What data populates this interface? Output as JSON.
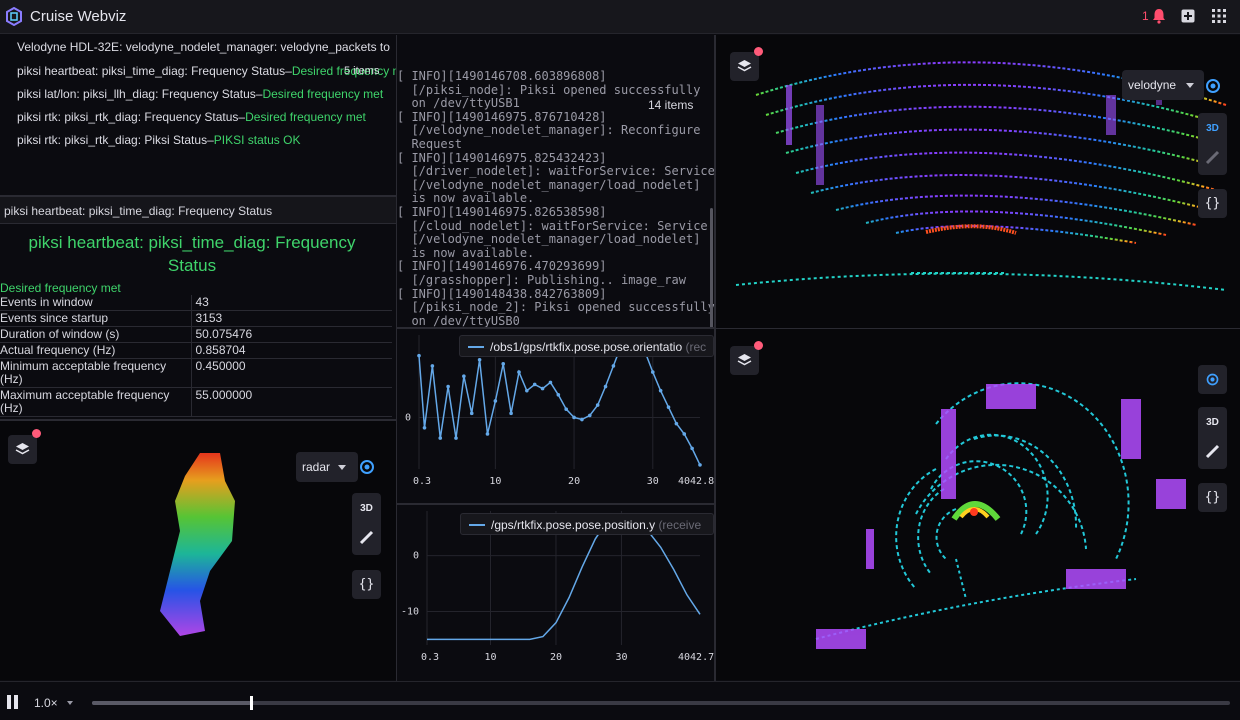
{
  "app": {
    "title": "Cruise Webviz",
    "notification_count": "1"
  },
  "diagnostics": {
    "item_count": "5 items",
    "items": [
      {
        "label": "Velodyne HDL-32E: velodyne_nodelet_manager: velodyne_packets to",
        "status": ""
      },
      {
        "label": "piksi heartbeat: piksi_time_diag: Frequency Status–",
        "status": "Desired frequency met"
      },
      {
        "label": "piksi lat/lon: piksi_llh_diag: Frequency Status–",
        "status": "Desired frequency met"
      },
      {
        "label": "piksi rtk: piksi_rtk_diag: Frequency Status–",
        "status": "Desired frequency met"
      },
      {
        "label": "piksi rtk: piksi_rtk_diag: Piksi Status–",
        "status": "PIKSI status OK"
      }
    ]
  },
  "detail": {
    "header": "piksi heartbeat: piksi_time_diag: Frequency Status",
    "title_line1": "piksi heartbeat: piksi_time_diag: Frequency",
    "title_line2": "Status",
    "status": "Desired frequency met",
    "rows": [
      {
        "key": "Events in window",
        "value": "43"
      },
      {
        "key": "Events since startup",
        "value": "3153"
      },
      {
        "key": "Duration of window (s)",
        "value": "50.075476"
      },
      {
        "key": "Actual frequency (Hz)",
        "value": "0.858704"
      },
      {
        "key": "Minimum acceptable frequency (Hz)",
        "value": "0.450000"
      },
      {
        "key": "Maximum acceptable frequency (Hz)",
        "value": "55.000000"
      }
    ]
  },
  "log": {
    "item_count": "14 items",
    "lines": [
      "[ INFO][1490146708.603896808]",
      "  [/piksi_node]: Piksi opened successfully",
      "  on /dev/ttyUSB1",
      "[ INFO][1490146975.876710428]",
      "  [/velodyne_nodelet_manager]: Reconfigure",
      "  Request",
      "[ INFO][1490146975.825432423]",
      "  [/driver_nodelet]: waitForService: Service",
      "  [/velodyne_nodelet_manager/load_nodelet]",
      "  is now available.",
      "[ INFO][1490146975.826538598]",
      "  [/cloud_nodelet]: waitForService: Service",
      "  [/velodyne_nodelet_manager/load_nodelet]",
      "  is now available.",
      "[ INFO][1490146976.470293699]",
      "  [/grasshopper]: Publishing.. image_raw",
      "[ INFO][1490148438.842763809]",
      "  [/piksi_node_2]: Piksi opened successfully",
      "  on /dev/ttyUSB0"
    ]
  },
  "plot_orientation": {
    "legend": "/obs1/gps/rtkfix.pose.pose.orientatio",
    "legend_suffix": "(rec",
    "x_ticks": [
      "0.3",
      "10",
      "20",
      "30",
      "4042.8"
    ],
    "y_ticks": [
      "0"
    ],
    "chart_data": {
      "type": "line",
      "series": [
        {
          "name": "/obs1/gps/rtkfix.pose.pose.orientatio",
          "points": [
            [
              0.3,
              3
            ],
            [
              1,
              -0.5
            ],
            [
              2,
              2.5
            ],
            [
              3,
              -1
            ],
            [
              4,
              1.5
            ],
            [
              5,
              -1
            ],
            [
              6,
              2
            ],
            [
              7,
              0.2
            ],
            [
              8,
              2.8
            ],
            [
              9,
              -0.8
            ],
            [
              10,
              0.8
            ],
            [
              11,
              2.6
            ],
            [
              12,
              0.2
            ],
            [
              13,
              2.2
            ],
            [
              14,
              1.3
            ],
            [
              15,
              1.6
            ],
            [
              16,
              1.4
            ],
            [
              17,
              1.7
            ],
            [
              18,
              1.1
            ],
            [
              19,
              0.4
            ],
            [
              20,
              0
            ],
            [
              21,
              -0.1
            ],
            [
              22,
              0.1
            ],
            [
              23,
              0.6
            ],
            [
              24,
              1.5
            ],
            [
              25,
              2.5
            ],
            [
              26,
              3.5
            ],
            [
              27,
              3.9
            ],
            [
              28,
              3.7
            ],
            [
              29,
              3.2
            ],
            [
              30,
              2.2
            ],
            [
              31,
              1.3
            ],
            [
              32,
              0.5
            ],
            [
              33,
              -0.3
            ],
            [
              34,
              -0.8
            ],
            [
              35,
              -1.5
            ],
            [
              36,
              -2.3
            ]
          ]
        }
      ]
    }
  },
  "plot_position": {
    "legend": "/gps/rtkfix.pose.pose.position.y",
    "legend_suffix": "(receive",
    "x_ticks": [
      "0.3",
      "10",
      "20",
      "30",
      "4042.7"
    ],
    "y_ticks": [
      "0",
      "-10"
    ],
    "chart_data": {
      "type": "line",
      "series": [
        {
          "name": "/gps/rtkfix.pose.pose.position.y",
          "points": [
            [
              0.3,
              -15
            ],
            [
              10,
              -15
            ],
            [
              16,
              -15
            ],
            [
              18,
              -14.5
            ],
            [
              20,
              -12
            ],
            [
              22,
              -7.5
            ],
            [
              24,
              -2
            ],
            [
              26,
              3
            ],
            [
              28,
              6.5
            ],
            [
              30,
              7.5
            ],
            [
              32,
              6.5
            ],
            [
              34,
              4.5
            ],
            [
              36,
              1.5
            ],
            [
              38,
              -2.5
            ],
            [
              40,
              -7
            ],
            [
              42,
              -10.5
            ]
          ]
        }
      ]
    }
  },
  "scene_top": {
    "topic": "velodyne",
    "tool_3d": "3D",
    "braces": "{}"
  },
  "scene_bottom": {
    "tool_3d": "3D",
    "braces": "{}"
  },
  "scene_radar": {
    "topic": "radar",
    "tool_3d": "3D",
    "braces": "{}"
  },
  "playback": {
    "speed": "1.0×",
    "progress": 0.14
  },
  "colors": {
    "accent_green": "#3fd46b",
    "plot_line": "#64a8e8",
    "alert_red": "#ff4d6d"
  }
}
